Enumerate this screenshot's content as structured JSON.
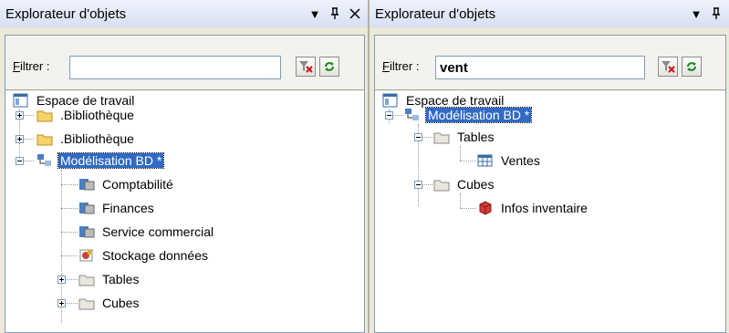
{
  "left": {
    "title": "Explorateur d'objets",
    "filter_label": "Filtrer :",
    "filter_value": "",
    "tree": {
      "workspace": "Espace de travail",
      "library1": ".Bibliothèque",
      "library2": ".Bibliothèque",
      "model": "Modélisation BD *",
      "items": [
        "Comptabilité",
        "Finances",
        "Service commercial",
        "Stockage données",
        "Tables",
        "Cubes"
      ]
    }
  },
  "right": {
    "title": "Explorateur d'objets",
    "filter_label": "Filtrer :",
    "filter_value": "vent",
    "tree": {
      "workspace": "Espace de travail",
      "model": "Modélisation BD *",
      "tables": "Tables",
      "ventes": "Ventes",
      "cubes": "Cubes",
      "infos": "Infos inventaire"
    }
  },
  "icons": {
    "dropdown": "dropdown-arrow-icon",
    "pin": "pin-icon",
    "close": "close-icon",
    "clear_filter": "clear-filter-icon",
    "refresh": "refresh-icon"
  }
}
